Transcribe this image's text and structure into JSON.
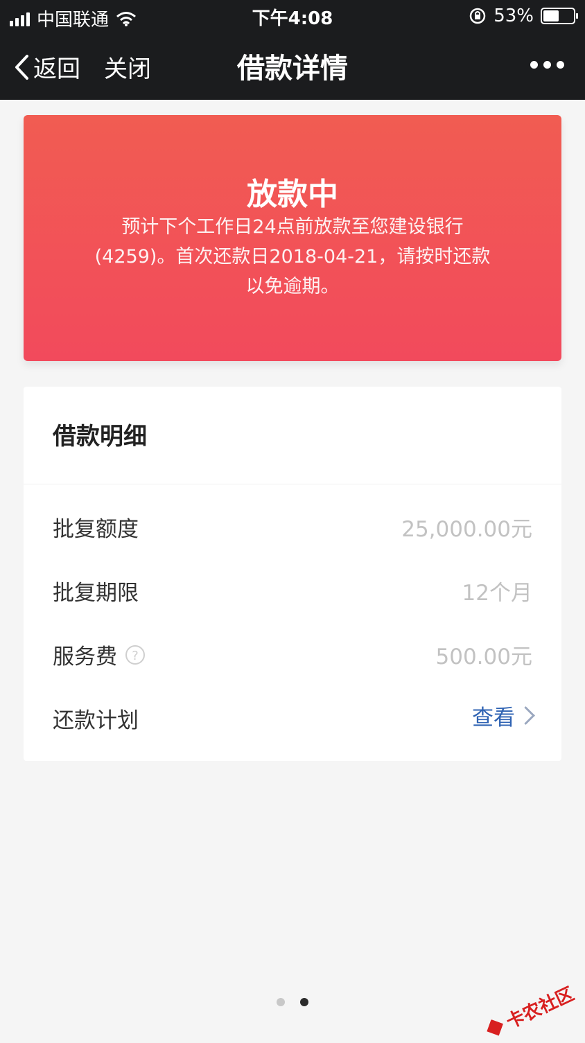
{
  "status_bar": {
    "carrier": "中国联通",
    "time": "下午4:08",
    "battery_percent": "53%",
    "battery_level": 0.53
  },
  "navbar": {
    "back_label": "返回",
    "close_label": "关闭",
    "title": "借款详情"
  },
  "banner": {
    "title": "放款中",
    "description": "预计下个工作日24点前放款至您建设银行(4259)。首次还款日2018-04-21，请按时还款以免逾期。",
    "bg_color_top": "#f15c52",
    "bg_color_bottom": "#f24a5c"
  },
  "detail": {
    "header": "借款明细",
    "rows": [
      {
        "label": "批复额度",
        "value": "25,000.00元"
      },
      {
        "label": "批复期限",
        "value": "12个月"
      },
      {
        "label": "服务费",
        "value": "500.00元"
      },
      {
        "label": "还款计划",
        "link": "查看"
      }
    ]
  },
  "pager": {
    "count": 2,
    "active_index": 1
  },
  "watermark": {
    "text": "卡农社区"
  },
  "colors": {
    "link": "#2f63b3",
    "value_gray": "#c2c2c2",
    "dark_bar": "#1b1c1e"
  }
}
